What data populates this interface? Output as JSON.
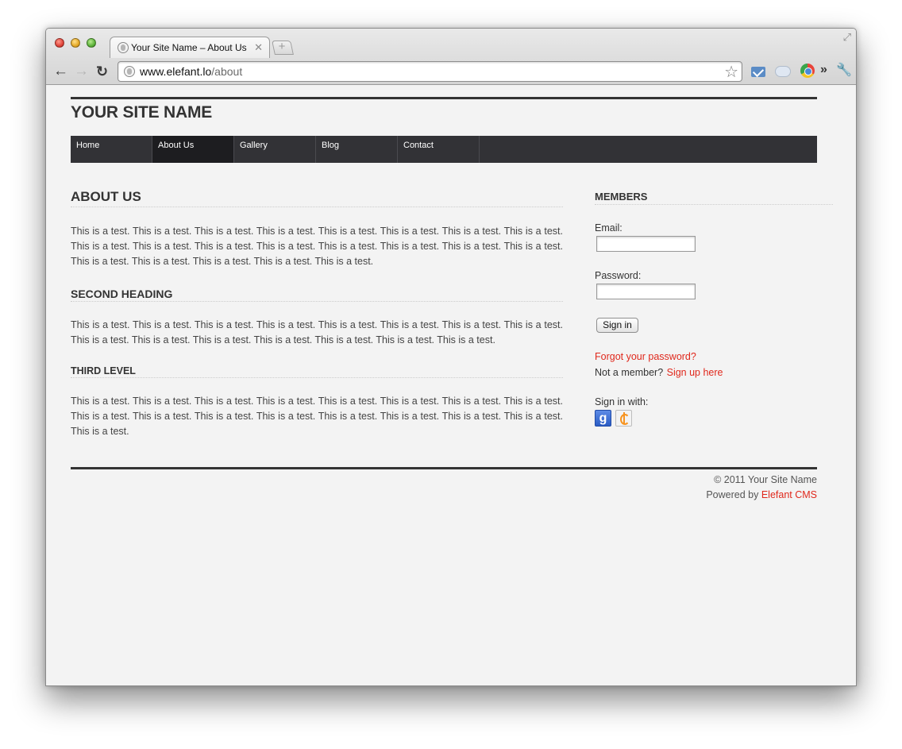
{
  "browser": {
    "tab_title": "Your Site Name – About Us",
    "url_host": "www.elefant.lo",
    "url_path": "/about"
  },
  "site": {
    "name": "YOUR SITE NAME",
    "nav": [
      {
        "label": "Home",
        "active": false
      },
      {
        "label": "About Us",
        "active": true
      },
      {
        "label": "Gallery",
        "active": false
      },
      {
        "label": "Blog",
        "active": false
      },
      {
        "label": "Contact",
        "active": false
      }
    ]
  },
  "content": {
    "heading1": "ABOUT US",
    "para1": "This is a test. This is a test. This is a test. This is a test. This is a test. This is a test. This is a test. This is a test. This is a test. This is a test. This is a test. This is a test. This is a test. This is a test. This is a test. This is a test. This is a test. This is a test. This is a test. This is a test. This is a test.",
    "heading2": "SECOND HEADING",
    "para2": "This is a test. This is a test. This is a test. This is a test. This is a test. This is a test. This is a test. This is a test. This is a test. This is a test. This is a test. This is a test. This is a test. This is a test. This is a test.",
    "heading3": "THIRD LEVEL",
    "para3": "This is a test. This is a test. This is a test. This is a test. This is a test. This is a test. This is a test. This is a test. This is a test. This is a test. This is a test. This is a test. This is a test. This is a test. This is a test. This is a test. This is a test."
  },
  "sidebar": {
    "title": "MEMBERS",
    "email_label": "Email:",
    "email_value": "",
    "password_label": "Password:",
    "password_value": "",
    "signin_button": "Sign in",
    "forgot_link": "Forgot your password?",
    "not_member": "Not a member?",
    "signup_link": "Sign up here",
    "signin_with": "Sign in with:",
    "providers": [
      "google-icon",
      "openid-icon"
    ]
  },
  "footer": {
    "copyright": "© 2011 Your Site Name",
    "powered_by": "Powered by",
    "cms_link": "Elefant CMS"
  },
  "colors": {
    "accent_link": "#e0281c",
    "nav_bg": "#323236",
    "nav_active_bg": "#1d1d20",
    "page_bg": "#f3f3f3"
  }
}
